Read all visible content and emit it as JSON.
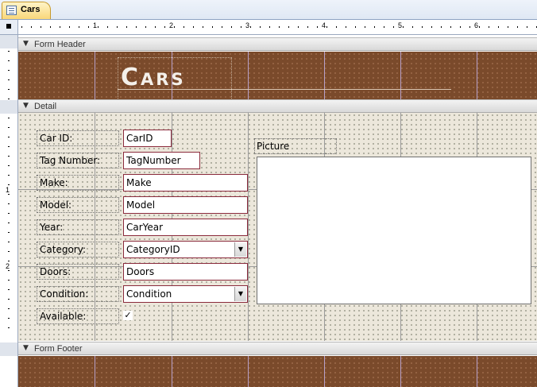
{
  "window": {
    "tab_label": "Cars"
  },
  "ruler": {
    "h_numbers": [
      "1",
      "2",
      "3",
      "4",
      "5",
      "6"
    ],
    "v_numbers": [
      "1",
      "2"
    ]
  },
  "sections": {
    "header_label": "Form Header",
    "detail_label": "Detail",
    "footer_label": "Form Footer"
  },
  "form_title": "Cars",
  "fields": [
    {
      "label": "Car ID:",
      "control": "CarID",
      "type": "textbox"
    },
    {
      "label": "Tag Number:",
      "control": "TagNumber",
      "type": "textbox"
    },
    {
      "label": "Make:",
      "control": "Make",
      "type": "textbox"
    },
    {
      "label": "Model:",
      "control": "Model",
      "type": "textbox"
    },
    {
      "label": "Year:",
      "control": "CarYear",
      "type": "textbox"
    },
    {
      "label": "Category:",
      "control": "CategoryID",
      "type": "combobox"
    },
    {
      "label": "Doors:",
      "control": "Doors",
      "type": "textbox"
    },
    {
      "label": "Condition:",
      "control": "Condition",
      "type": "combobox"
    },
    {
      "label": "Available:",
      "control": "✓",
      "type": "checkbox"
    }
  ],
  "picture": {
    "label": "Picture"
  },
  "colors": {
    "section_brown": "#7a4a2b",
    "detail_bg": "#ece7db",
    "field_border": "#8b2b3c",
    "tab_active": "#f9d77a"
  },
  "icons": {
    "tab": "form-icon",
    "section": "collapse-arrow-icon",
    "dropdown": "dropdown-arrow-icon"
  }
}
